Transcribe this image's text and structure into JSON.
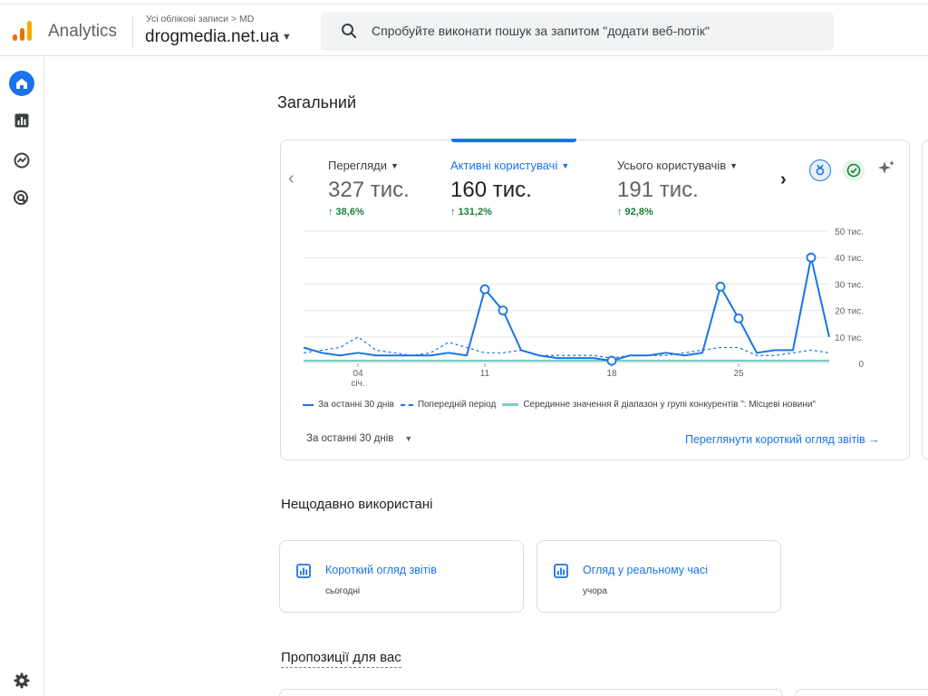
{
  "header": {
    "app_name": "Analytics",
    "breadcrumb": "Усі облікові записи > MD",
    "account": "drogmedia.net.ua",
    "search_placeholder": "Спробуйте виконати пошук за запитом \"додати веб-потік\""
  },
  "nav": {
    "items": [
      "home-icon",
      "reports-icon",
      "explore-icon",
      "advertising-icon"
    ],
    "settings": "settings-gear-icon"
  },
  "main": {
    "title": "Загальний",
    "metrics": [
      {
        "label": "Перегляди",
        "value": "327 тис.",
        "delta": "↑ 38,6%",
        "active": false
      },
      {
        "label": "Активні користувачі",
        "value": "160 тис.",
        "delta": "↑ 131,2%",
        "active": true
      },
      {
        "label": "Усього користувачів",
        "value": "191 тис.",
        "delta": "↑ 92,8%",
        "active": false
      }
    ],
    "period_selector": "За останні 30 днів",
    "view_link": "Переглянути короткий огляд звітів",
    "recent_title": "Нещодавно використані",
    "recent": [
      {
        "title": "Короткий огляд звітів",
        "subtitle": "сьогодні"
      },
      {
        "title": "Огляд у реальному часі",
        "subtitle": "учора"
      }
    ],
    "suggestions_title": "Пропозиції для вас"
  },
  "colors": {
    "accent": "#1a73e8",
    "positive": "#188038",
    "benchmark": "#80cbc4"
  },
  "chart_data": {
    "type": "line",
    "x_ticks": [
      {
        "day": 4,
        "label": "04",
        "sublabel": "січ."
      },
      {
        "day": 11,
        "label": "11",
        "sublabel": ""
      },
      {
        "day": 18,
        "label": "18",
        "sublabel": ""
      },
      {
        "day": 25,
        "label": "25",
        "sublabel": ""
      }
    ],
    "y_ticks": [
      "0",
      "10 тис.",
      "20 тис.",
      "30 тис.",
      "40 тис.",
      "50 тис."
    ],
    "y_tick_values": [
      0,
      10,
      20,
      30,
      40,
      50
    ],
    "ylim": [
      0,
      50
    ],
    "x_range": [
      1,
      30
    ],
    "grid": true,
    "series": [
      {
        "name": "За останні 30 днів",
        "style": "solid",
        "x": [
          1,
          2,
          3,
          4,
          5,
          6,
          7,
          8,
          9,
          10,
          11,
          12,
          13,
          14,
          15,
          16,
          17,
          18,
          19,
          20,
          21,
          22,
          23,
          24,
          25,
          26,
          27,
          28,
          29,
          30
        ],
        "values": [
          6,
          4,
          3,
          4,
          3,
          3,
          3,
          3,
          4,
          3,
          28,
          20,
          5,
          3,
          2,
          2,
          2,
          1,
          3,
          3,
          4,
          3,
          4,
          29,
          17,
          4,
          5,
          5,
          40,
          10
        ],
        "markers": [
          11,
          12,
          18,
          24,
          25,
          29
        ]
      },
      {
        "name": "Попередній період",
        "style": "dashed",
        "x": [
          1,
          2,
          3,
          4,
          5,
          6,
          7,
          8,
          9,
          10,
          11,
          12,
          13,
          14,
          15,
          16,
          17,
          18,
          19,
          20,
          21,
          22,
          23,
          24,
          25,
          26,
          27,
          28,
          29,
          30
        ],
        "values": [
          4,
          5,
          6,
          10,
          5,
          4,
          3,
          4,
          8,
          6,
          4,
          4,
          5,
          3,
          3,
          3,
          3,
          2,
          3,
          3,
          3,
          4,
          5,
          6,
          6,
          3,
          3,
          4,
          5,
          4
        ]
      },
      {
        "name": "Серединне значення й діапазон у групі конкурентів \": Місцеві новини\"",
        "style": "band",
        "x": [
          1,
          30
        ],
        "values": [
          1,
          1
        ]
      }
    ]
  }
}
